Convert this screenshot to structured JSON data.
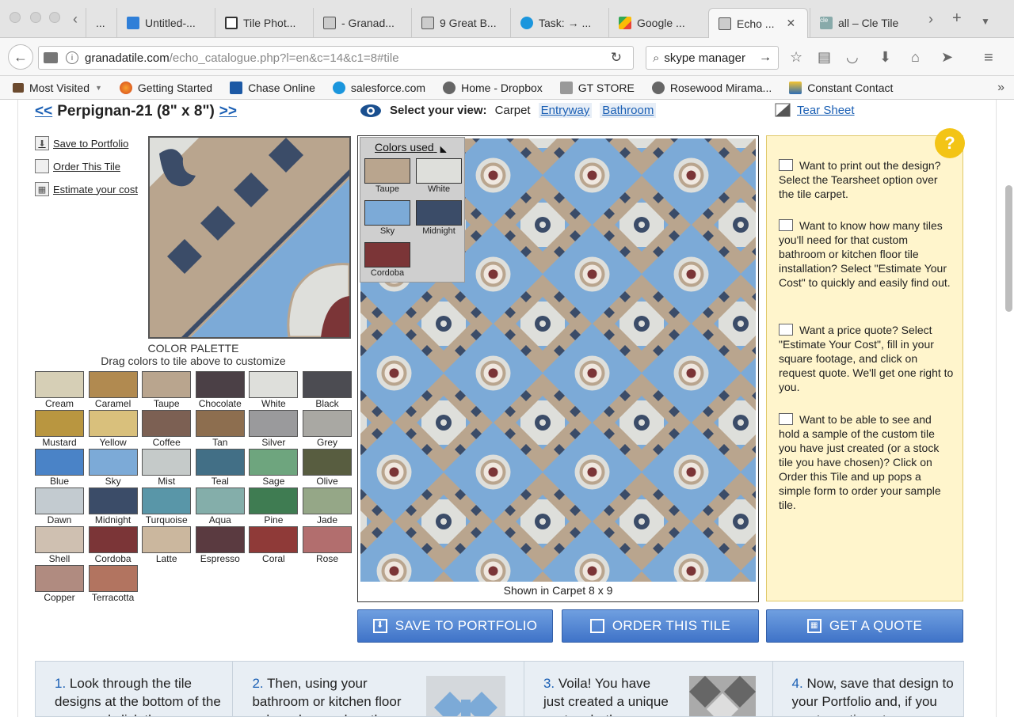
{
  "browser": {
    "tabs": [
      {
        "title": "...",
        "favicon": "page-icon"
      },
      {
        "title": "Untitled-...",
        "favicon": "dropbox-icon"
      },
      {
        "title": "Tile Phot...",
        "favicon": "gt-icon"
      },
      {
        "title": "- Granad...",
        "favicon": "granada-icon"
      },
      {
        "title": "9 Great B...",
        "favicon": "granada-icon"
      },
      {
        "title": "Task: → ...",
        "favicon": "salesforce-icon"
      },
      {
        "title": "Google ...",
        "favicon": "maps-icon"
      },
      {
        "title": "Echo ...",
        "favicon": "granada-icon",
        "active": true
      },
      {
        "title": "all – Cle Tile",
        "favicon": "cle-icon"
      }
    ],
    "url_host": "granadatile.com",
    "url_path": "/echo_catalogue.php?l=en&c=14&c1=8#tile",
    "search_value": "skype manager",
    "bookmarks": [
      {
        "label": "Most Visited",
        "icon": "most-visited-icon"
      },
      {
        "label": "Getting Started",
        "icon": "firefox-icon"
      },
      {
        "label": "Chase Online",
        "icon": "chase-icon"
      },
      {
        "label": "salesforce.com",
        "icon": "salesforce-icon"
      },
      {
        "label": "Home - Dropbox",
        "icon": "globe-icon"
      },
      {
        "label": "GT STORE",
        "icon": "gt-icon"
      },
      {
        "label": "Rosewood Mirama...",
        "icon": "globe-icon"
      },
      {
        "label": "Constant Contact",
        "icon": "constant-contact-icon"
      }
    ]
  },
  "product": {
    "prev": "<<",
    "title": "Perpignan-21 (8\" x 8\")",
    "next": ">>"
  },
  "side_links": {
    "save": "Save to Portfolio",
    "order": "Order This Tile",
    "estimate": "Estimate your cost"
  },
  "view": {
    "label": "Select your view:",
    "current": "Carpet",
    "options": [
      "Entryway",
      "Bathroom"
    ],
    "tear_sheet": "Tear Sheet"
  },
  "palette": {
    "title": "COLOR PALETTE",
    "subtitle": "Drag colors to tile above to customize",
    "colors": [
      {
        "name": "Cream",
        "hex": "#d6cfb6"
      },
      {
        "name": "Caramel",
        "hex": "#b18a50"
      },
      {
        "name": "Taupe",
        "hex": "#b9a58e"
      },
      {
        "name": "Chocolate",
        "hex": "#4b4046"
      },
      {
        "name": "White",
        "hex": "#dedfdb"
      },
      {
        "name": "Black",
        "hex": "#4c4c52"
      },
      {
        "name": "Mustard",
        "hex": "#b99640"
      },
      {
        "name": "Yellow",
        "hex": "#d9c07c"
      },
      {
        "name": "Coffee",
        "hex": "#7c6053"
      },
      {
        "name": "Tan",
        "hex": "#8d6e4f"
      },
      {
        "name": "Silver",
        "hex": "#9a9a9c"
      },
      {
        "name": "Grey",
        "hex": "#a9a8a3"
      },
      {
        "name": "Blue",
        "hex": "#4a83c7"
      },
      {
        "name": "Sky",
        "hex": "#7caad7"
      },
      {
        "name": "Mist",
        "hex": "#c5cac9"
      },
      {
        "name": "Teal",
        "hex": "#426f86"
      },
      {
        "name": "Sage",
        "hex": "#6ea57e"
      },
      {
        "name": "Olive",
        "hex": "#585d40"
      },
      {
        "name": "Dawn",
        "hex": "#c3cbd0"
      },
      {
        "name": "Midnight",
        "hex": "#3b4c68"
      },
      {
        "name": "Turquoise",
        "hex": "#5996a8"
      },
      {
        "name": "Aqua",
        "hex": "#84aeaa"
      },
      {
        "name": "Pine",
        "hex": "#3f7c52"
      },
      {
        "name": "Jade",
        "hex": "#95a787"
      },
      {
        "name": "Shell",
        "hex": "#cfc0b1"
      },
      {
        "name": "Cordoba",
        "hex": "#7b3537"
      },
      {
        "name": "Latte",
        "hex": "#cbb79e"
      },
      {
        "name": "Espresso",
        "hex": "#5a3a40"
      },
      {
        "name": "Coral",
        "hex": "#8f3a38"
      },
      {
        "name": "Rose",
        "hex": "#b26e6e"
      },
      {
        "name": "Copper",
        "hex": "#b08b80"
      },
      {
        "name": "Terracotta",
        "hex": "#b27460"
      }
    ]
  },
  "colors_used": {
    "title": "Colors used",
    "colors": [
      {
        "name": "Taupe",
        "hex": "#b9a58e"
      },
      {
        "name": "White",
        "hex": "#dedfdb"
      },
      {
        "name": "Sky",
        "hex": "#7caad7"
      },
      {
        "name": "Midnight",
        "hex": "#3b4c68"
      },
      {
        "name": "Cordoba",
        "hex": "#7b3537"
      }
    ]
  },
  "carpet": {
    "caption": "Shown in Carpet 8 x 9"
  },
  "help": {
    "badge": "?",
    "items": [
      "Want to print out the design? Select the Tearsheet option over the tile carpet.",
      "Want to know how many tiles you'll need for that custom bathroom or kitchen floor tile installation? Select \"Estimate Your Cost\" to quickly and easily find out.",
      "Want a price quote? Select \"Estimate Your Cost\", fill in your square footage, and click on request quote. We'll get one right to you.",
      "Want to be able to see and hold a sample of the custom tile you have just created (or a stock tile you have chosen)? Click on Order this Tile and up pops a simple form to order your sample tile."
    ]
  },
  "buttons": {
    "save": "SAVE TO PORTFOLIO",
    "order": "ORDER THIS TILE",
    "quote": "GET A QUOTE"
  },
  "steps": [
    {
      "num": "1.",
      "text": "Look through the tile designs at the bottom of the page and click the"
    },
    {
      "num": "2.",
      "text": "Then, using your bathroom or kitchen floor color scheme, drag the"
    },
    {
      "num": "3.",
      "text": "Voila! You have just created a unique custom bathroom or"
    },
    {
      "num": "4.",
      "text": "Now, save that design to your Portfolio and, if you want, continue to"
    }
  ]
}
